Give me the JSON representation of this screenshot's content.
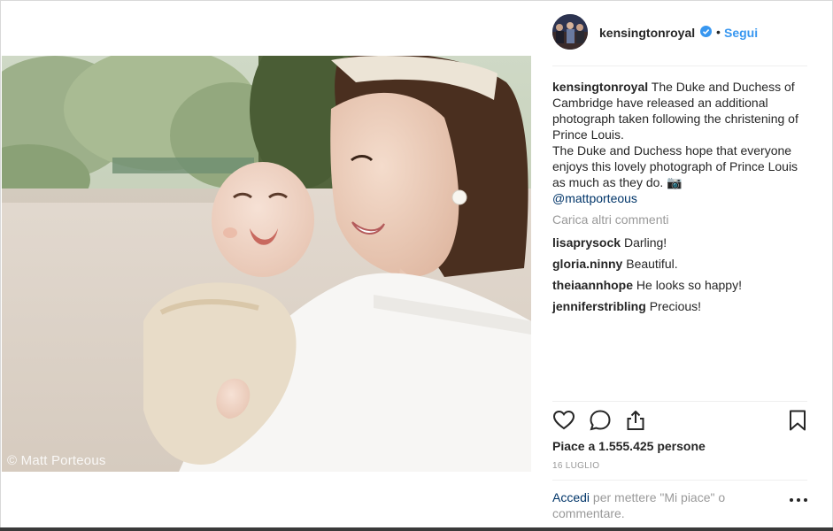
{
  "post": {
    "photo_watermark": "© Matt Porteous",
    "photo_icons": [
      "photo-of-mother-and-baby"
    ]
  },
  "header": {
    "username": "kensingtonroyal",
    "separator": "•",
    "follow_label": "Segui"
  },
  "caption": {
    "username": "kensingtonroyal",
    "text_1": "The Duke and Duchess of Cambridge have released an additional photograph taken following the christening of Prince Louis.",
    "text_2": "The Duke and Duchess hope that everyone enjoys this lovely photograph of Prince Louis as much as they do. 📷",
    "mention": "@mattporteous"
  },
  "load_more_label": "Carica altri commenti",
  "comments": [
    {
      "user": "lisaprysock",
      "text": "Darling!"
    },
    {
      "user": "gloria.ninny",
      "text": "Beautiful."
    },
    {
      "user": "theiaannhope",
      "text": "He looks so happy!"
    },
    {
      "user": "jenniferstribling",
      "text": "Precious!"
    }
  ],
  "actions": {
    "like_icon": "heart-icon",
    "comment_icon": "comment-icon",
    "share_icon": "share-icon",
    "save_icon": "bookmark-icon"
  },
  "likes_text": "Piace a 1.555.425 persone",
  "date": "16 LUGLIO",
  "login": {
    "link": "Accedi",
    "rest": " per mettere \"Mi piace\" o commentare."
  },
  "colors": {
    "accent": "#3897f0",
    "link": "#003569",
    "muted": "#999999",
    "text": "#262626"
  }
}
